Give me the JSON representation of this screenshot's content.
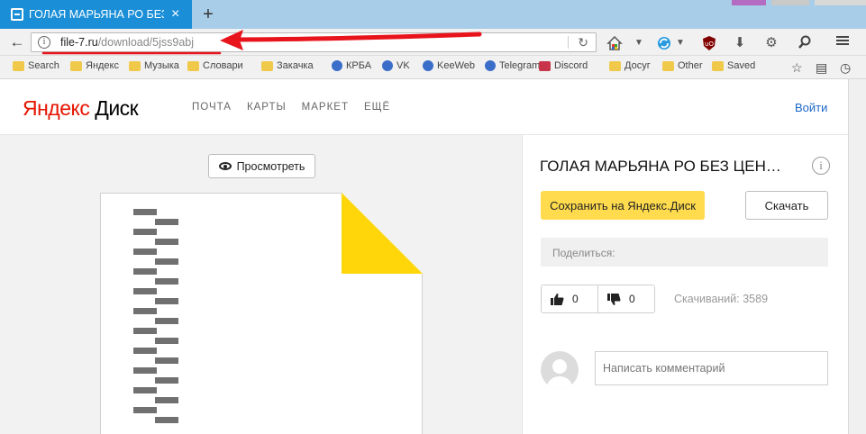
{
  "browser": {
    "tab_title": "ГОЛАЯ МАРЬЯНА РО БЕЗ Ц",
    "tab_close": "×",
    "new_tab": "+",
    "url_host": "file-7.ru",
    "url_path": "/download/5jss9abj",
    "bookmarks": [
      {
        "label": "Search",
        "icon": "folder"
      },
      {
        "label": "Яндекс",
        "icon": "folder"
      },
      {
        "label": "Музыка",
        "icon": "folder"
      },
      {
        "label": "Словари",
        "icon": "folder"
      },
      {
        "label": "Закачка",
        "icon": "folder"
      },
      {
        "label": "КРБА",
        "icon": "globe"
      },
      {
        "label": "VK",
        "icon": "vk"
      },
      {
        "label": "KeeWeb",
        "icon": "globe"
      },
      {
        "label": "Telegram",
        "icon": "globe"
      },
      {
        "label": "Discord",
        "icon": "discord"
      },
      {
        "label": "Досуг",
        "icon": "folder"
      },
      {
        "label": "Other",
        "icon": "folder"
      },
      {
        "label": "Saved",
        "icon": "folder"
      }
    ]
  },
  "site": {
    "logo_brand": "Яндекс",
    "logo_product": " Диск",
    "nav": [
      "ПОЧТА",
      "КАРТЫ",
      "МАРКЕТ",
      "ЕЩЁ"
    ],
    "login": "Войти"
  },
  "preview": {
    "button_label": "Просмотреть"
  },
  "file": {
    "title": "ГОЛАЯ МАРЬЯНА РО БЕЗ ЦЕН…",
    "save_label": "Сохранить на Яндекс.Диск",
    "download_label": "Скачать",
    "share_label": "Поделиться:",
    "likes": "0",
    "dislikes": "0",
    "downloads": "Скачиваний: 3589",
    "comment_placeholder": "Написать комментарий"
  },
  "colors": {
    "tab_active": "#1a8fd8",
    "yandex_red": "#e61400",
    "save_yellow": "#ffdb4d",
    "fold_yellow": "#ffd60a",
    "link_blue": "#1a66c8",
    "annotation_red": "#e8141c"
  }
}
